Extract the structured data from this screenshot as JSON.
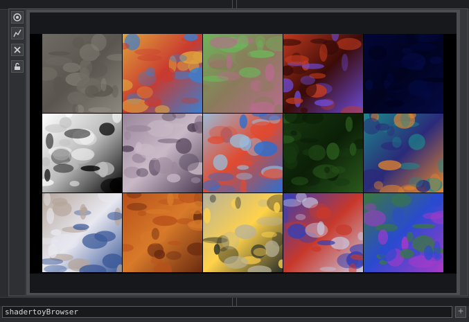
{
  "toolbar": {
    "buttons": [
      {
        "name": "viewer-active",
        "icon": "eye-icon"
      },
      {
        "name": "wiring",
        "icon": "pulse-icon"
      },
      {
        "name": "close",
        "icon": "close-icon"
      },
      {
        "name": "lock",
        "icon": "lock-icon"
      }
    ]
  },
  "gallery": {
    "tiles": [
      {
        "name": "tile-gray-noise",
        "colors": [
          "#6f6a62",
          "#8d887f",
          "#5a564f"
        ]
      },
      {
        "name": "tile-psychedelic-swirl",
        "colors": [
          "#e0a33b",
          "#3a7fd0",
          "#c93a2f"
        ]
      },
      {
        "name": "tile-liquid-marble",
        "colors": [
          "#6db45a",
          "#b86c8e",
          "#8a7b5a"
        ]
      },
      {
        "name": "tile-red-fire-nebula",
        "colors": [
          "#c0391e",
          "#6a4ad8",
          "#3a0b08"
        ]
      },
      {
        "name": "tile-dark-navy",
        "colors": [
          "#020636",
          "#040a44",
          "#01031f"
        ]
      },
      {
        "name": "tile-white-crack-pattern",
        "colors": [
          "#ffffff",
          "#000000",
          "#bbbbbb"
        ]
      },
      {
        "name": "tile-metallic-purple",
        "colors": [
          "#9a869b",
          "#4b3a52",
          "#c9b9c7"
        ]
      },
      {
        "name": "tile-rainbow-blob",
        "colors": [
          "#9bbad6",
          "#2b6fd0",
          "#e04a30"
        ]
      },
      {
        "name": "tile-dark-green",
        "colors": [
          "#173a10",
          "#2a5a1c",
          "#0b1f07"
        ]
      },
      {
        "name": "tile-teal-orange-veins",
        "colors": [
          "#1c8a8a",
          "#e8862a",
          "#2a2a7a"
        ]
      },
      {
        "name": "tile-blue-smoke-balls",
        "colors": [
          "#b5a59a",
          "#3c5a9a",
          "#e8e8f0"
        ]
      },
      {
        "name": "tile-orange-marble",
        "colors": [
          "#b8501a",
          "#6a2a10",
          "#d87a2a"
        ]
      },
      {
        "name": "tile-glowing-ember",
        "colors": [
          "#b7b29a",
          "#2a2f2a",
          "#ffd24a"
        ]
      },
      {
        "name": "tile-circuit-maze",
        "colors": [
          "#3a3fb0",
          "#c8c8e0",
          "#c8382a"
        ]
      },
      {
        "name": "tile-color-confetti",
        "colors": [
          "#3a7a3a",
          "#a83ac8",
          "#2a4ad0"
        ]
      }
    ]
  },
  "status_bar": {
    "label": "shadertoyBrowser",
    "add_button": "+"
  }
}
